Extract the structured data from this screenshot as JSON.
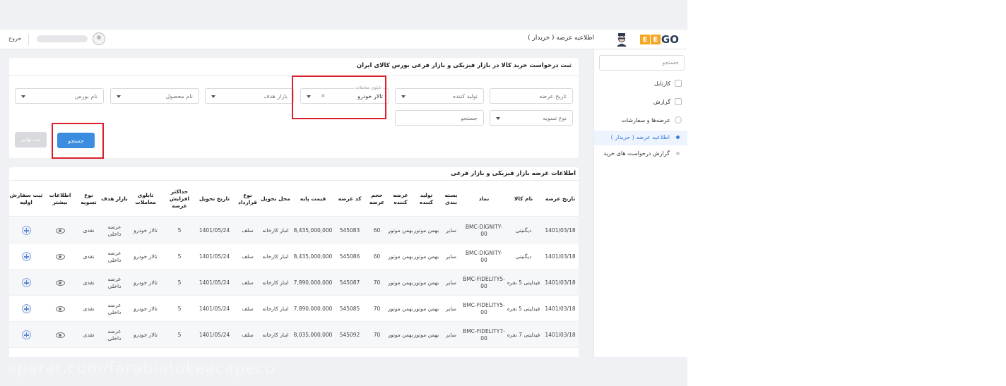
{
  "header": {
    "logo_mark": "E",
    "logo_text": "GO",
    "page_title": "اطلاعیه عرضه ( خریدار )",
    "exit_label": "خروج"
  },
  "sidebar": {
    "search_placeholder": "جستجو",
    "items": [
      {
        "label": "کارتابل"
      },
      {
        "label": "گزارش"
      },
      {
        "label": "عرضه‌ها و سفارشات"
      },
      {
        "label": "اطلاعیه عرضه ( خریدار )"
      },
      {
        "label": "گزارش درخواست های خرید"
      }
    ]
  },
  "search_panel": {
    "title": "ثبت درخواست خرید کالا در بازار فیزیکی و بازار فرعی بورس کالای ایران",
    "fields": {
      "offer_date": "تاریخ عرضه",
      "producer": "تولید کننده",
      "trading_floor_label": "تابلوی معاملات",
      "trading_floor_value": "تالار خودرو",
      "clear_mark": "×",
      "target_market": "بازار هدف",
      "product_name": "نام محصول",
      "exchange_name": "نام بورس",
      "settlement_type": "نوع تسویه",
      "search_text": "جستجو"
    },
    "search_button": "جستجو",
    "final_button": "ثبت نهایی"
  },
  "table": {
    "title": "اطلاعات عرضه بازار فیزیکی و بازار فرعی",
    "headers": [
      "تاریخ عرضه",
      "نام کالا",
      "نماد",
      "بسته بندی",
      "تولید کننده",
      "عرضه کننده",
      "حجم عرضه",
      "کد عرضه",
      "قیمت پایه",
      "محل تحویل",
      "نوع قرارداد",
      "تاریخ تحویل",
      "حداکثر افزایش عرضه",
      "تابلوی معاملات",
      "بازار هدف",
      "نوع تسویه",
      "اطلاعات بیشتر",
      "ثبت سفارش اولیه"
    ],
    "rows": [
      {
        "date": "1401/03/18",
        "name": "دیگنیتی",
        "symbol": "BMC-DIGNITY-00",
        "packing": "سایر",
        "producer": "بهمن موتور",
        "supplier": "بهمن موتور",
        "volume": "60",
        "code": "545083",
        "price": "8,435,000,000",
        "delivery_place": "انبار کارخانه",
        "contract": "سلف",
        "delivery_date": "1401/05/24",
        "max_increase": "5",
        "board": "تالار خودرو",
        "market": "عرضه داخلی",
        "settlement": "نقدی"
      },
      {
        "date": "1401/03/18",
        "name": "دیگنیتی",
        "symbol": "BMC-DIGNITY-00",
        "packing": "سایر",
        "producer": "بهمن موتور",
        "supplier": "بهمن موتور",
        "volume": "60",
        "code": "545086",
        "price": "8,435,000,000",
        "delivery_place": "انبار کارخانه",
        "contract": "سلف",
        "delivery_date": "1401/05/24",
        "max_increase": "5",
        "board": "تالار خودرو",
        "market": "عرضه داخلی",
        "settlement": "نقدی"
      },
      {
        "date": "1401/03/18",
        "name": "فیدلیتی 5 نفره",
        "symbol": "BMC-FIDELITY5-00",
        "packing": "سایر",
        "producer": "بهمن موتور",
        "supplier": "بهمن موتور",
        "volume": "70",
        "code": "545087",
        "price": "7,890,000,000",
        "delivery_place": "انبار کارخانه",
        "contract": "سلف",
        "delivery_date": "1401/05/24",
        "max_increase": "5",
        "board": "تالار خودرو",
        "market": "عرضه داخلی",
        "settlement": "نقدی"
      },
      {
        "date": "1401/03/18",
        "name": "فیدلیتی 5 نفره",
        "symbol": "BMC-FIDELITY5-00",
        "packing": "سایر",
        "producer": "بهمن موتور",
        "supplier": "بهمن موتور",
        "volume": "70",
        "code": "545085",
        "price": "7,890,000,000",
        "delivery_place": "انبار کارخانه",
        "contract": "سلف",
        "delivery_date": "1401/05/24",
        "max_increase": "5",
        "board": "تالار خودرو",
        "market": "عرضه داخلی",
        "settlement": "نقدی"
      },
      {
        "date": "1401/03/18",
        "name": "فیدلیتی 7 نفره",
        "symbol": "BMC-FIDELITY7-00",
        "packing": "سایر",
        "producer": "بهمن موتور",
        "supplier": "بهمن موتور",
        "volume": "70",
        "code": "545092",
        "price": "8,035,000,000",
        "delivery_place": "انبار کارخانه",
        "contract": "سلف",
        "delivery_date": "1401/05/24",
        "max_increase": "5",
        "board": "تالار خودرو",
        "market": "عرضه داخلی",
        "settlement": "نقدی"
      }
    ]
  },
  "icons": {
    "more_info": "eye-icon",
    "order": "plus-circle-icon",
    "avatar": "mascot-avatar-icon"
  },
  "colors": {
    "accent": "#3c8ce0",
    "highlight_box": "#d8212b",
    "logo_orange": "#f5a623",
    "logo_navy": "#2c3a55"
  },
  "watermark": "aparat.com/farabiatokeacapeco"
}
